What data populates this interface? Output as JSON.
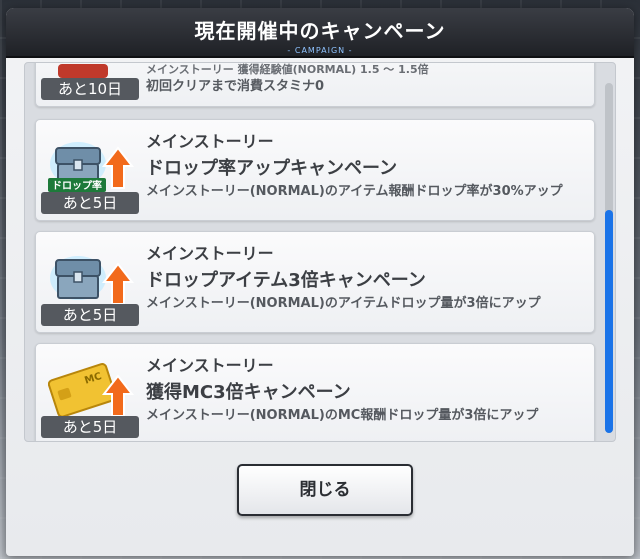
{
  "dialog": {
    "title": "現在開催中のキャンペーン",
    "subtitle": "- CAMPAIGN -",
    "close_label": "閉じる"
  },
  "campaigns": [
    {
      "category": "",
      "name": "メインストーリー 獲得経験値(NORMAL) 1.5 ～ 1.5倍",
      "description": "初回クリアまで消費スタミナ0",
      "days_left": "あと10日",
      "icon": "campaign-badge-icon"
    },
    {
      "category": "メインストーリー",
      "name": "ドロップ率アップキャンペーン",
      "description": "メインストーリー(NORMAL)のアイテム報酬ドロップ率が30%アップ",
      "days_left": "あと5日",
      "icon": "treasure-chest-drop-rate-icon",
      "icon_label": "ドロップ率"
    },
    {
      "category": "メインストーリー",
      "name": "ドロップアイテム3倍キャンペーン",
      "description": "メインストーリー(NORMAL)のアイテムドロップ量が3倍にアップ",
      "days_left": "あと5日",
      "icon": "treasure-chest-icon"
    },
    {
      "category": "メインストーリー",
      "name": "獲得MC3倍キャンペーン",
      "description": "メインストーリー(NORMAL)のMC報酬ドロップ量が3倍にアップ",
      "days_left": "あと5日",
      "icon": "mc-card-icon",
      "icon_label": "MC"
    }
  ],
  "colors": {
    "accent": "#1a73e8",
    "arrow": "#f26a1b",
    "badge": "#55595f"
  }
}
